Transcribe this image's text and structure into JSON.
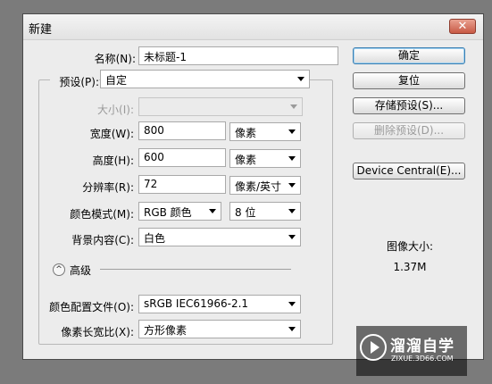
{
  "window": {
    "title": "新建",
    "close_glyph": "✕"
  },
  "form": {
    "name": {
      "label": "名称(N):",
      "value": "未标题-1"
    },
    "preset": {
      "label": "预设(P):",
      "value": "自定"
    },
    "size": {
      "label": "大小(I):",
      "value": ""
    },
    "width": {
      "label": "宽度(W):",
      "value": "800",
      "unit": "像素"
    },
    "height": {
      "label": "高度(H):",
      "value": "600",
      "unit": "像素"
    },
    "resolution": {
      "label": "分辨率(R):",
      "value": "72",
      "unit": "像素/英寸"
    },
    "color_mode": {
      "label": "颜色模式(M):",
      "value": "RGB 颜色",
      "depth": "8 位"
    },
    "background": {
      "label": "背景内容(C):",
      "value": "白色"
    },
    "advanced": {
      "label": "高级",
      "toggle_glyph": "^"
    },
    "color_profile": {
      "label": "颜色配置文件(O):",
      "value": "sRGB IEC61966-2.1"
    },
    "pixel_aspect": {
      "label": "像素长宽比(X):",
      "value": "方形像素"
    }
  },
  "buttons": {
    "ok": "确定",
    "reset": "复位",
    "save_preset": "存储预设(S)...",
    "delete_preset": "删除预设(D)...",
    "device_central": "Device Central(E)..."
  },
  "image_size": {
    "label": "图像大小:",
    "value": "1.37M"
  },
  "watermark": {
    "brand": "溜溜自学",
    "url": "ZIXUE.3D66.COM"
  }
}
